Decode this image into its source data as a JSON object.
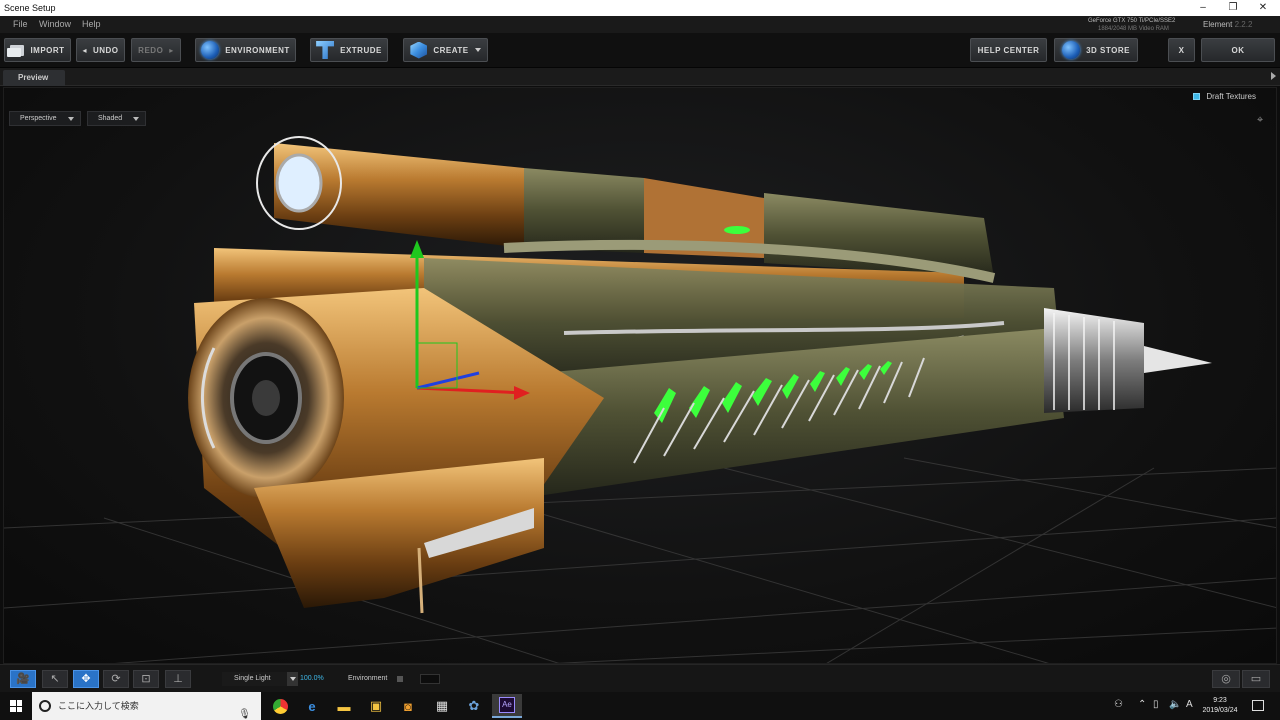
{
  "window": {
    "title": "Scene Setup",
    "minimize": "–",
    "restore": "❐",
    "close": "✕"
  },
  "menu": {
    "items": [
      "File",
      "Window",
      "Help"
    ],
    "gpu_name": "GeForce GTX 750 Ti/PCIe/SSE2",
    "gpu_vram": "1884/2048 MB Video RAM",
    "product": "Element",
    "version": "2.2.2"
  },
  "toolbar": {
    "import": "IMPORT",
    "undo": "UNDO",
    "redo": "REDO",
    "environment": "ENVIRONMENT",
    "extrude": "EXTRUDE",
    "create": "CREATE",
    "help_center": "HELP CENTER",
    "store": "3D STORE",
    "cancel": "X",
    "ok": "OK"
  },
  "preview": {
    "tab": "Preview",
    "draft_textures": "Draft Textures",
    "camera": "Perspective",
    "shading": "Shaded"
  },
  "bottom": {
    "light": "Single Light",
    "light_pct": "100.0%",
    "environment": "Environment"
  },
  "taskbar": {
    "search_placeholder": "ここに入力して検索",
    "ime": "A",
    "time": "9:23",
    "date": "2019/03/24"
  },
  "colors": {
    "accent": "#2a73c7",
    "highlight": "#3fb8e8",
    "copper": "#b8792e",
    "glow_green": "#3cff3c"
  }
}
